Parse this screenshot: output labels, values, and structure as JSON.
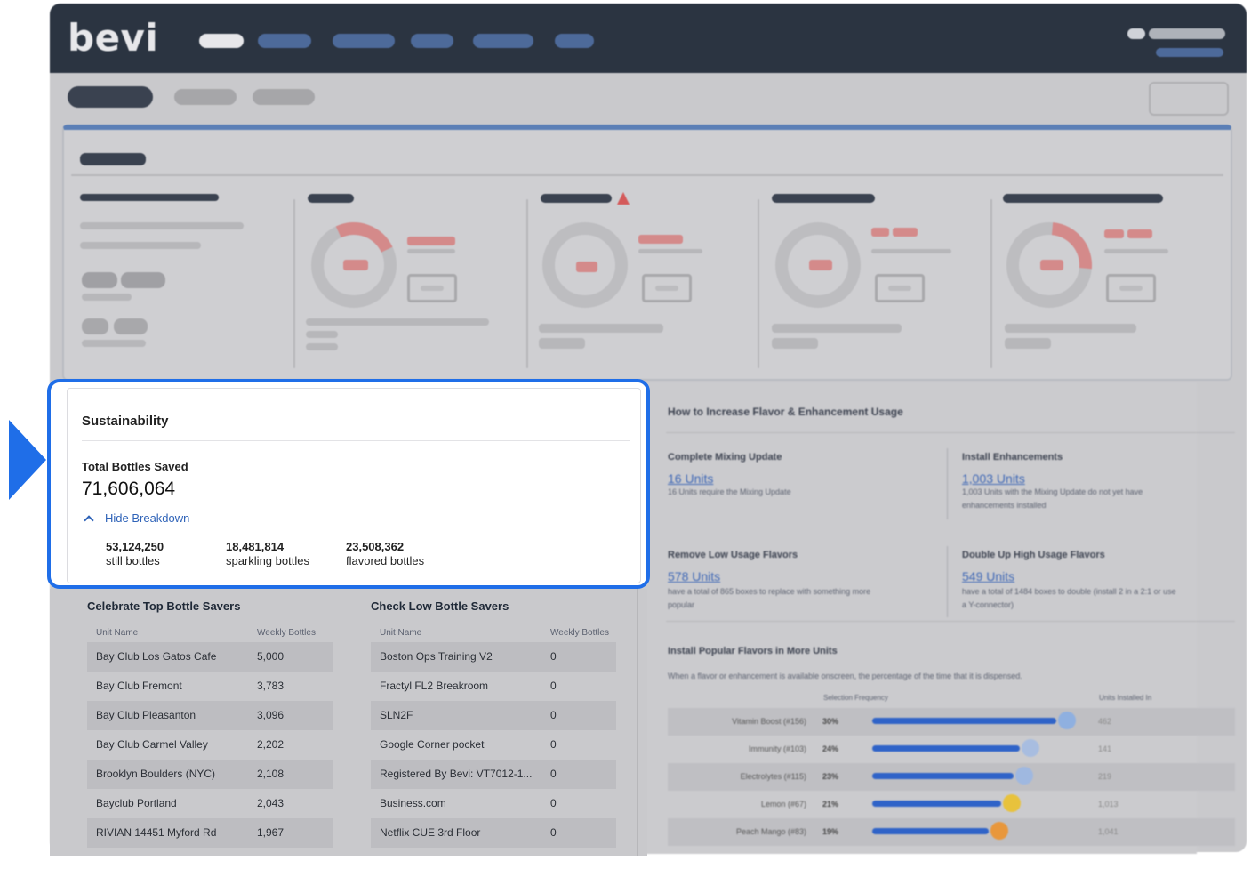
{
  "header": {
    "logo": "bevi"
  },
  "sustainability": {
    "title": "Sustainability",
    "total_label": "Total Bottles Saved",
    "total_value": "71,606,064",
    "toggle_label": "Hide Breakdown",
    "breakdown": [
      {
        "value": "53,124,250",
        "label": "still bottles"
      },
      {
        "value": "18,481,814",
        "label": "sparkling bottles"
      },
      {
        "value": "23,508,362",
        "label": "flavored bottles"
      }
    ]
  },
  "top_savers": {
    "title": "Celebrate Top Bottle Savers",
    "col_unit": "Unit Name",
    "col_weekly": "Weekly Bottles",
    "rows": [
      {
        "name": "Bay Club Los Gatos Cafe",
        "value": "5,000"
      },
      {
        "name": "Bay Club Fremont",
        "value": "3,783"
      },
      {
        "name": "Bay Club Pleasanton",
        "value": "3,096"
      },
      {
        "name": "Bay Club Carmel Valley",
        "value": "2,202"
      },
      {
        "name": "Brooklyn Boulders (NYC)",
        "value": "2,108"
      },
      {
        "name": "Bayclub Portland",
        "value": "2,043"
      },
      {
        "name": "RIVIAN 14451 Myford Rd",
        "value": "1,967"
      }
    ]
  },
  "low_savers": {
    "title": "Check Low Bottle Savers",
    "col_unit": "Unit Name",
    "col_weekly": "Weekly Bottles",
    "rows": [
      {
        "name": "Boston Ops Training V2",
        "value": "0"
      },
      {
        "name": "Fractyl FL2 Breakroom",
        "value": "0"
      },
      {
        "name": "SLN2F",
        "value": "0"
      },
      {
        "name": "Google Corner pocket",
        "value": "0"
      },
      {
        "name": "Registered By Bevi: VT7012-1...",
        "value": "0"
      },
      {
        "name": "Business.com",
        "value": "0"
      },
      {
        "name": "Netflix CUE 3rd Floor",
        "value": "0"
      }
    ]
  },
  "flavor_panel": {
    "title": "How to Increase Flavor & Enhancement Usage",
    "items": [
      {
        "title": "Complete Mixing Update",
        "link": "16 Units",
        "desc": "16 Units require the Mixing Update"
      },
      {
        "title": "Install Enhancements",
        "link": "1,003 Units",
        "desc": "1,003 Units with the Mixing Update do not yet have",
        "desc2": "enhancements installed"
      },
      {
        "title": "Remove Low Usage Flavors",
        "link": "578 Units",
        "desc": "have a total of 865 boxes to replace with something more",
        "desc2": "popular"
      },
      {
        "title": "Double Up High Usage Flavors",
        "link": "549 Units",
        "desc": "have a total of 1484 boxes to double (install 2 in a 2:1 or use",
        "desc2": "a Y-connector)"
      }
    ],
    "popular_title": "Install Popular Flavors in More Units",
    "popular_desc": "When a flavor or enhancement is available onscreen, the percentage of the time that it is dispensed.",
    "col_freq": "Selection Frequency",
    "col_units": "Units Installed In",
    "flavors": [
      {
        "name": "Vitamin Boost (#156)",
        "pct": "30%",
        "fill": 0.3,
        "units": "462",
        "icon_color": "#8fb0e0"
      },
      {
        "name": "Immunity (#103)",
        "pct": "24%",
        "fill": 0.24,
        "units": "141",
        "icon_color": "#a8bde0"
      },
      {
        "name": "Electrolytes (#115)",
        "pct": "23%",
        "fill": 0.23,
        "units": "219",
        "icon_color": "#9fb8e0"
      },
      {
        "name": "Lemon (#67)",
        "pct": "21%",
        "fill": 0.21,
        "units": "1,013",
        "icon_color": "#e8c23c"
      },
      {
        "name": "Peach Mango (#83)",
        "pct": "19%",
        "fill": 0.19,
        "units": "1,041",
        "icon_color": "#e8973c"
      }
    ]
  }
}
